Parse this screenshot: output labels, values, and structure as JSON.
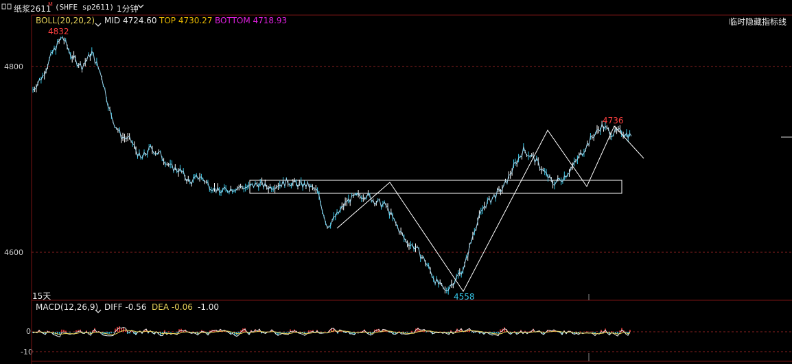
{
  "titlebar": {
    "code_icon": "chart-icon",
    "name": "纸浆2611",
    "badge": "M",
    "exchange": "(SHFE sp2611)",
    "period": "1分钟",
    "chevron": "chevron-down-icon"
  },
  "boll": {
    "label": "BOLL(20,20,2)",
    "mid": "MID 4724.60",
    "top": "TOP 4730.27",
    "bottom": "BOTTOM 4718.93",
    "color_label": "#e8d35a",
    "color_mid": "#e8e8e8",
    "color_top": "#e8b800",
    "color_bottom": "#e020e0"
  },
  "hide_indicator_button": "临时隐藏指标线",
  "price_axis": {
    "ticks": [
      "4800",
      "4600"
    ]
  },
  "annotations": {
    "high": "4832",
    "low": "4558",
    "recent_high": "4736",
    "range_note": "15天"
  },
  "macd": {
    "label": "MACD(12,26,9)",
    "diff": "DIFF -0.56",
    "dea": "DEA -0.06",
    "value": "-1.00",
    "ticks": [
      "0",
      "-10"
    ]
  },
  "chart_data": {
    "type": "line",
    "title": "",
    "ylim": [
      4540,
      4850
    ],
    "grid": true,
    "series": [
      {
        "values": [
          4775,
          4790,
          4815,
          4832,
          4810,
          4800,
          4815,
          4790,
          4745,
          4725,
          4720,
          4700,
          4712,
          4705,
          4692,
          4688,
          4675,
          4682,
          4672,
          4665,
          4668,
          4670,
          4670,
          4674,
          4670,
          4673,
          4676,
          4673,
          4672,
          4665,
          4628,
          4640,
          4655,
          4660,
          4662,
          4654,
          4650,
          4630,
          4612,
          4605,
          4590,
          4570,
          4558,
          4570,
          4585,
          4625,
          4650,
          4660,
          4670,
          4692,
          4710,
          4702,
          4688,
          4674,
          4680,
          4692,
          4708,
          4724,
          4736,
          4728,
          4730,
          4725
        ]
      }
    ]
  }
}
